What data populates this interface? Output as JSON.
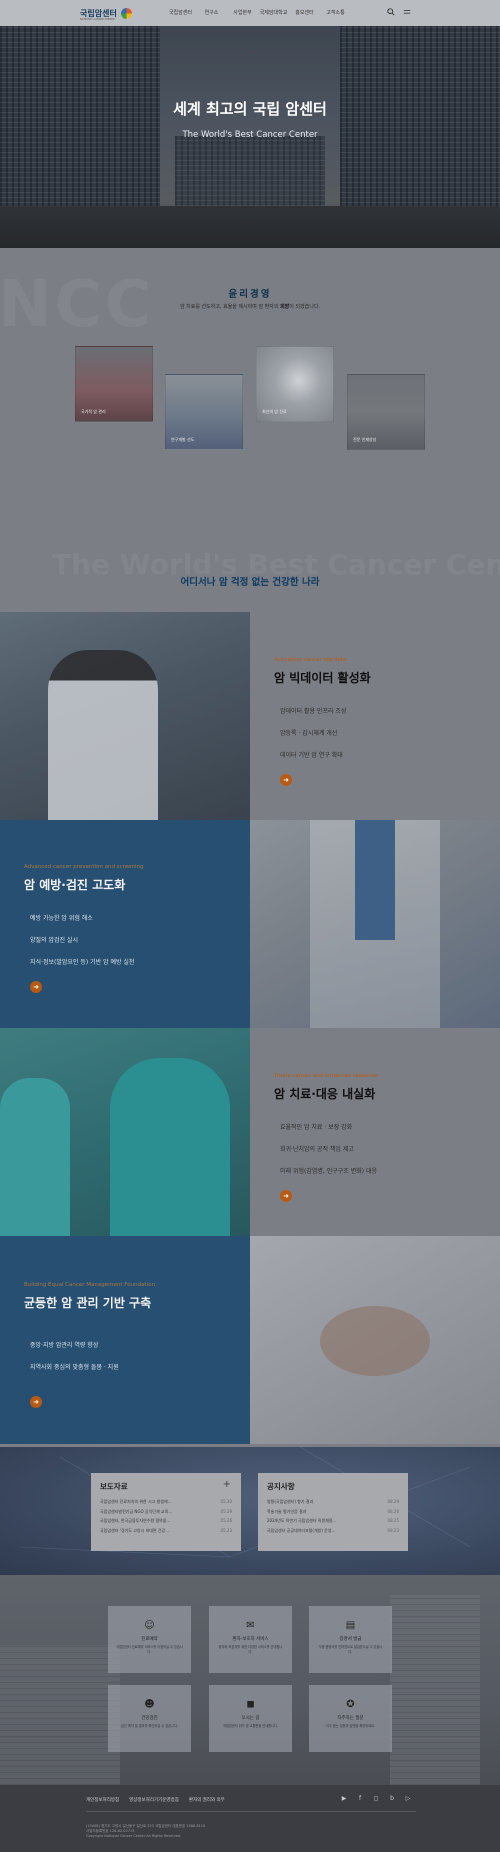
{
  "header": {
    "logo_text": "국립암센터",
    "logo_sub": "NATIONAL CANCER CENTER",
    "nav": [
      "국립암센터",
      "연구소",
      "사업본부",
      "국제암대학교",
      "홍보센터",
      "고객소통"
    ],
    "icons": [
      "search-icon",
      "menu-icon"
    ]
  },
  "hero": {
    "title": "세계 최고의 국립 암센터",
    "subtitle": "The World's Best Cancer Center"
  },
  "ethics": {
    "bg_word": "NCC",
    "title": "윤리경영",
    "desc_pre": "암 치료를 선도하고, 효율을 제시하며 암 환자의 ",
    "desc_bold": "희망",
    "desc_post": "이 되겠습니다.",
    "cards": [
      {
        "label": "국가적 암 관리"
      },
      {
        "label": "연구개발 선도"
      },
      {
        "label": "최선의 암 진료"
      },
      {
        "label": "전문 인재양성"
      }
    ],
    "bg_slogan": "The World's Best Cancer Center",
    "tagline": "어디서나 암 걱정 없는 건강한 나라"
  },
  "sections": [
    {
      "kicker": "Activating cancer big data",
      "title": "암 빅데이터 활성화",
      "items": [
        "암데이터 활용 인프라 조성",
        "암등록 · 감시체계 개선",
        "데이터 기반 암 연구 확대"
      ]
    },
    {
      "kicker": "Advanced cancer prevention and screening",
      "title": "암 예방·검진 고도화",
      "items": [
        "예방 가능한 암 위험 해소",
        "양질의 암검진 실시",
        "지식·정보(발암요인 등) 기반 암 예방 실천"
      ]
    },
    {
      "kicker": "Treats cancer and enhances response",
      "title": "암 치료·대응 내실화",
      "items": [
        "효율적인 암 치료 · 보장 강화",
        "희귀·난치암의 공적 책임 제고",
        "미래 위험(감염병, 인구구조 변화) 대응"
      ]
    },
    {
      "kicker": "Building Equal Cancer Management Foundation",
      "title": "균등한 암 관리 기반 구축",
      "items": [
        "중앙·지방 암관리 역량 향상",
        "지역사회 중심의 맞춤형 돌봄 · 지원"
      ]
    }
  ],
  "news": {
    "press": {
      "title": "보도자료",
      "items": [
        {
          "text": "국립암센터 진료지속의 위한 시고 발생에...",
          "date": "05.30"
        },
        {
          "text": "국립암센터발전기금 NGO 공익단체 교육...",
          "date": "05.29"
        },
        {
          "text": "국립암센터, 한국금융투자연수원 협약을...",
          "date": "05.26"
        },
        {
          "text": "국립암센터 ‘경기도 고양시 비대면 건강...",
          "date": "05.23"
        }
      ]
    },
    "notice": {
      "title": "공지사항",
      "items": [
        {
          "text": "병원(국립암센터) 향기 결과",
          "date": "08.29"
        },
        {
          "text": "학술기술 평가인증 결과",
          "date": "08.26"
        },
        {
          "text": "2024년도 하반기 국립암센터 직원채용...",
          "date": "08.25"
        },
        {
          "text": "국립암센터 공공데이터포털(개방) 운영...",
          "date": "08.23"
        }
      ]
    }
  },
  "links": {
    "tiles": [
      {
        "icon": "person-icon",
        "title": "진료예약",
        "sub": "국립암센터 진료예약 서비스를 이용하실 수 있습니다."
      },
      {
        "icon": "help-icon",
        "title": "환자·보호자 서비스",
        "sub": "환자와 보호자를 위한 다양한 서비스를 안내합니다."
      },
      {
        "icon": "document-icon",
        "title": "증명서 발급",
        "sub": "각종 증명서를 인터넷으로 발급받으실 수 있습니다."
      },
      {
        "icon": "user-icon",
        "title": "건강검진",
        "sub": "검진 예약 및 결과를 확인하실 수 있습니다."
      },
      {
        "icon": "car-icon",
        "title": "오시는 길",
        "sub": "국립암센터 위치 및 교통편을 안내합니다."
      },
      {
        "icon": "medal-icon",
        "title": "자주하는 질문",
        "sub": "자주 묻는 질문과 답변을 확인하세요."
      }
    ]
  },
  "footer": {
    "links": [
      "개인정보처리방침",
      "영상정보처리기기운영방침",
      "환자의 권리와 의무"
    ],
    "social": [
      "youtube-icon",
      "facebook-icon",
      "instagram-icon",
      "blog-icon",
      "play-icon"
    ],
    "copy1": "(10408) 경기도 고양시 일산동구 일산로 323 국립암센터 대표번호 1588-8110",
    "copy2": "사업자등록번호 128-82-02713",
    "copy3": "Copyright National Cancer Center All Rights Reserved."
  },
  "colors": {
    "navy": "#274f71",
    "accent": "#b85a12",
    "title_blue": "#0e3a63"
  }
}
